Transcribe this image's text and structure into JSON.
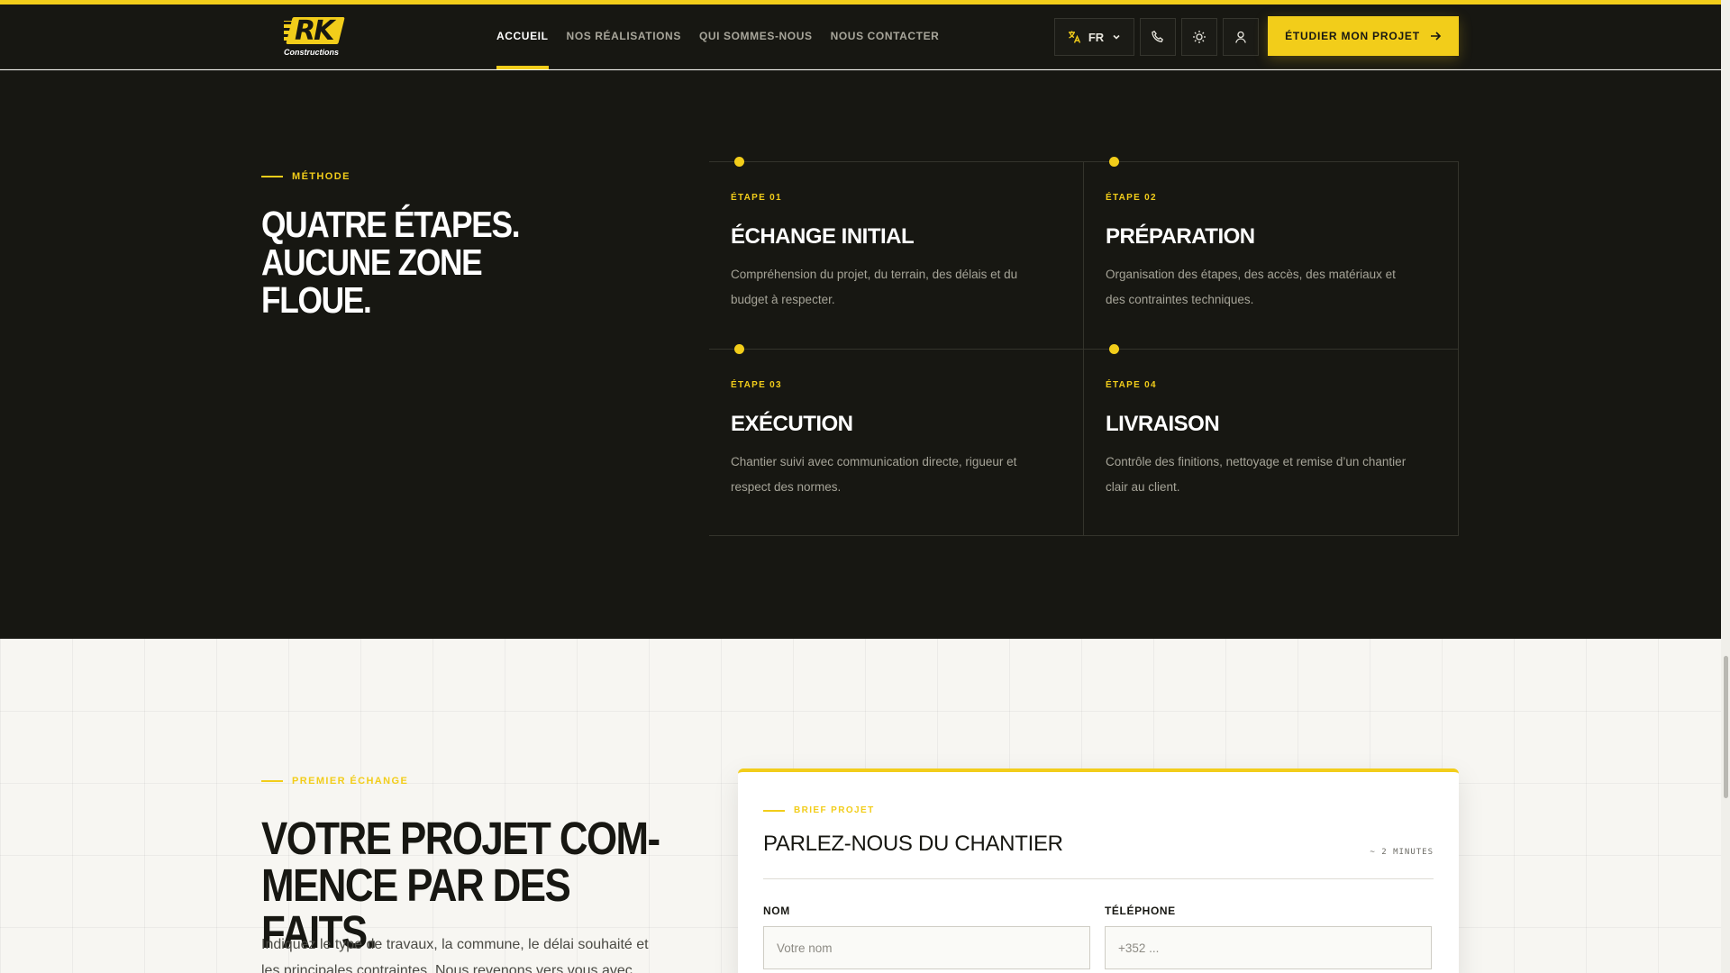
{
  "colors": {
    "accent": "#f2cd1a",
    "dark_bg": "#171712",
    "light_bg": "#f7f6f2"
  },
  "header": {
    "logo_text": "RK",
    "logo_sub": "Constructions",
    "nav": [
      {
        "label": "Accueil",
        "active": true
      },
      {
        "label": "Nos réalisations",
        "active": false
      },
      {
        "label": "Qui sommes-nous",
        "active": false
      },
      {
        "label": "Nous contacter",
        "active": false
      }
    ],
    "language": "FR",
    "icons": [
      "translate-icon",
      "chevron-down-icon",
      "phone-icon",
      "sun-icon",
      "user-icon",
      "arrow-right-icon"
    ],
    "cta_label": "Étudier mon projet"
  },
  "method": {
    "eyebrow": "Méthode",
    "title_line1": "Quatre étapes.",
    "title_line2": "Aucune zone floue.",
    "steps": [
      {
        "number": "Étape 01",
        "title": "Échange initial",
        "desc": "Compréhension du projet, du terrain, des délais et du budget à respecter."
      },
      {
        "number": "Étape 02",
        "title": "Préparation",
        "desc": "Organisation des étapes, des accès, des matériaux et des contraintes techniques."
      },
      {
        "number": "Étape 03",
        "title": "Exécution",
        "desc": "Chantier suivi avec communication directe, rigueur et respect des normes."
      },
      {
        "number": "Étape 04",
        "title": "Livraison",
        "desc": "Contrôle des finitions, nettoyage et remise d’un chantier clair au client."
      }
    ]
  },
  "contact": {
    "eyebrow": "Premier échange",
    "title_line1": "Votre projet com-",
    "title_line2": "mence par des faits.",
    "text": "Indiquez le type de travaux, la commune, le délai souhaité et les principales contraintes. Nous revenons vers vous avec les",
    "form": {
      "eyebrow": "Brief projet",
      "title": "Parlez-nous du chantier",
      "meta": "~ 2 minutes",
      "fields": [
        {
          "label": "Nom",
          "placeholder": "Votre nom",
          "value": ""
        },
        {
          "label": "Téléphone",
          "placeholder": "+352 ...",
          "value": ""
        }
      ]
    }
  }
}
